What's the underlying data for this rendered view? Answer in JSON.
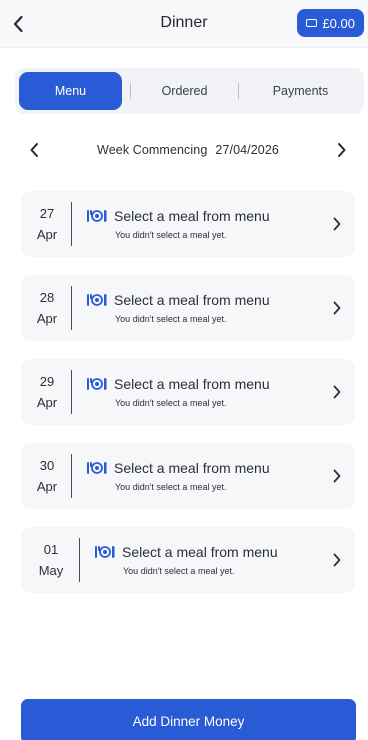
{
  "header": {
    "title": "Dinner",
    "balance": "£0.00"
  },
  "tabs": [
    {
      "label": "Menu",
      "active": true
    },
    {
      "label": "Ordered",
      "active": false
    },
    {
      "label": "Payments",
      "active": false
    }
  ],
  "week": {
    "prefix": "Week Commencing",
    "date": "27/04/2026"
  },
  "days": [
    {
      "day": "27",
      "month": "Apr",
      "title": "Select a meal from menu",
      "subtitle": "You didn't select a meal yet."
    },
    {
      "day": "28",
      "month": "Apr",
      "title": "Select a meal from menu",
      "subtitle": "You didn't select a meal yet."
    },
    {
      "day": "29",
      "month": "Apr",
      "title": "Select a meal from menu",
      "subtitle": "You didn't select a meal yet."
    },
    {
      "day": "30",
      "month": "Apr",
      "title": "Select a meal from menu",
      "subtitle": "You didn't select a meal yet."
    },
    {
      "day": "01",
      "month": "May",
      "title": "Select a meal from menu",
      "subtitle": "You didn't select a meal yet."
    }
  ],
  "footer": {
    "button_label": "Add Dinner Money"
  },
  "colors": {
    "accent": "#2a5bd7",
    "card_bg": "#f6f7f9"
  },
  "icons": {
    "back": "chevron-left-icon",
    "balance": "wallet-icon",
    "meal": "cutlery-icon",
    "day_chevron": "chevron-right-icon"
  }
}
